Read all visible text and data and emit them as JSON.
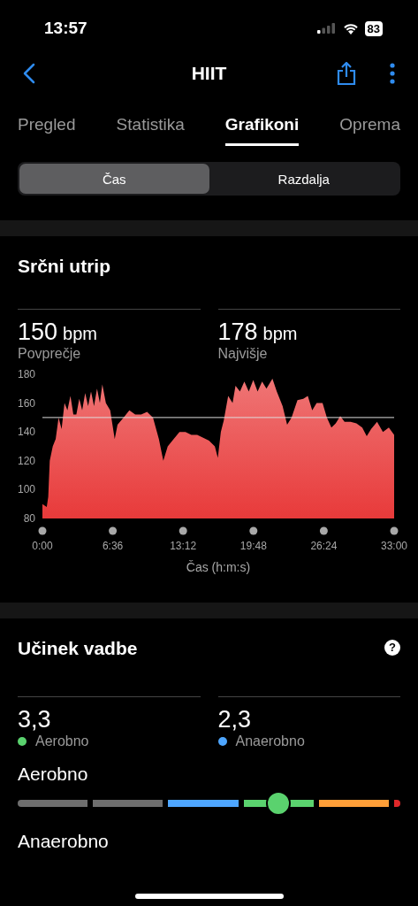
{
  "status_bar": {
    "time": "13:57",
    "battery": "83"
  },
  "nav": {
    "title": "HIIT"
  },
  "tabs": [
    {
      "label": "Pregled",
      "selected": false
    },
    {
      "label": "Statistika",
      "selected": false
    },
    {
      "label": "Grafikoni",
      "selected": true
    },
    {
      "label": "Oprema",
      "selected": false
    }
  ],
  "segments": [
    {
      "label": "Čas",
      "selected": true
    },
    {
      "label": "Razdalja",
      "selected": false
    }
  ],
  "heart_rate": {
    "title": "Srčni utrip",
    "stats": [
      {
        "value": "150",
        "unit": "bpm",
        "label": "Povprečje"
      },
      {
        "value": "178",
        "unit": "bpm",
        "label": "Najvišje"
      }
    ],
    "chart_data": {
      "type": "area",
      "xlabel": "Čas (h:m:s)",
      "x": [
        0,
        0.41,
        0.55,
        0.69,
        0.97,
        1.24,
        1.52,
        1.8,
        2.07,
        2.35,
        2.63,
        2.9,
        3.18,
        3.46,
        3.73,
        4.01,
        4.29,
        4.56,
        4.84,
        5.12,
        5.39,
        5.62,
        5.95,
        6.36,
        6.78,
        7.05,
        7.61,
        8.16,
        8.71,
        9.27,
        9.82,
        10.37,
        10.93,
        11.34,
        11.76,
        12.31,
        12.86,
        13.42,
        13.97,
        14.52,
        15.08,
        15.63,
        16.18,
        16.46,
        16.74,
        17.01,
        17.43,
        17.84,
        18.12,
        18.53,
        18.95,
        19.36,
        19.78,
        20.19,
        20.61,
        21.02,
        21.58,
        21.99,
        22.54,
        22.96,
        23.37,
        23.93,
        24.48,
        24.9,
        25.31,
        25.73,
        26.28,
        26.69,
        27.11,
        27.52,
        27.94,
        28.35,
        28.91,
        29.46,
        30.01,
        30.43,
        30.84,
        31.4,
        31.95,
        32.5,
        33
      ],
      "series": [
        {
          "color": "#e83a3a",
          "values": [
            90,
            88,
            95,
            120,
            130,
            135,
            150,
            142,
            160,
            155,
            165,
            152,
            152,
            163,
            155,
            167,
            158,
            168,
            158,
            170,
            160,
            173,
            160,
            155,
            135,
            145,
            150,
            155,
            152,
            152,
            154,
            150,
            135,
            120,
            130,
            135,
            140,
            140,
            138,
            138,
            136,
            134,
            130,
            122,
            140,
            148,
            165,
            160,
            172,
            168,
            175,
            168,
            176,
            168,
            175,
            170,
            177,
            168,
            158,
            145,
            150,
            162,
            163,
            165,
            155,
            160,
            160,
            150,
            143,
            146,
            151,
            147,
            147,
            146,
            143,
            137,
            142,
            147,
            140,
            143,
            138
          ]
        }
      ],
      "xlim": [
        0,
        33
      ],
      "ylim": [
        80,
        180
      ],
      "xticks": [
        {
          "value": 0,
          "label": "0:00"
        },
        {
          "value": 6.6,
          "label": "6:36"
        },
        {
          "value": 13.2,
          "label": "13:12"
        },
        {
          "value": 19.8,
          "label": "19:48"
        },
        {
          "value": 26.4,
          "label": "26:24"
        },
        {
          "value": 33,
          "label": "33:00"
        }
      ],
      "yticks": [
        80,
        100,
        120,
        140,
        160,
        180
      ],
      "ref_lines": [
        {
          "axis": "y",
          "value": 150
        }
      ]
    }
  },
  "training_effect": {
    "title": "Učinek vadbe",
    "help": "?",
    "stats": [
      {
        "value": "3,3",
        "label": "Aerobno",
        "color": "#5ad26e"
      },
      {
        "value": "2,3",
        "label": "Anaerobno",
        "color": "#4ea6ff"
      }
    ],
    "scales": [
      {
        "label": "Aerobno",
        "segments": [
          {
            "color": "#6e6e6e",
            "selected": false
          },
          {
            "color": "#6e6e6e",
            "selected": false
          },
          {
            "color": "#4ea6ff",
            "selected": false
          },
          {
            "color": "#5ad26e",
            "selected": true
          },
          {
            "color": "#ff9f38",
            "selected": false
          },
          {
            "color": "#e0282a",
            "selected": false
          }
        ]
      },
      {
        "label": "Anaerobno"
      }
    ]
  }
}
